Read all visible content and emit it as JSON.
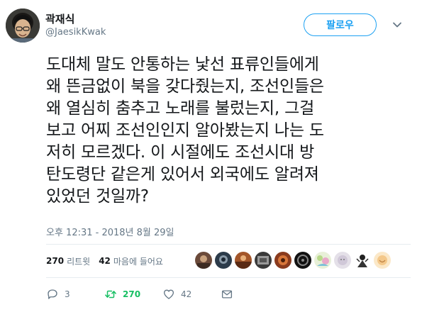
{
  "author": {
    "name": "곽재식",
    "handle": "@JaesikKwak"
  },
  "follow_button": {
    "label": "팔로우",
    "color": "#1da1f2"
  },
  "tweet": {
    "text": "도대체 말도 안통하는 낯선 표류인들에게\n왜 뜬금없이 북을 갖다줬는지, 조선인들은\n왜 열심히 춤추고 노래를 불렀는지, 그걸\n보고 어찌 조선인인지 알아봤는지 나는 도\n저히 모르겠다. 이 시절에도 조선시대 방\n탄도령단 같은게 있어서 외국에도 알려져\n있었던 것일까?",
    "timestamp": "오후 12:31 - 2018년 8월 29일"
  },
  "stats": {
    "retweets_count": "270",
    "retweets_label": "리트윗",
    "likes_count": "42",
    "likes_label": "마음에 들어요"
  },
  "likers": [
    {
      "icon": "avatar-1"
    },
    {
      "icon": "avatar-2"
    },
    {
      "icon": "avatar-3"
    },
    {
      "icon": "avatar-4"
    },
    {
      "icon": "avatar-5"
    },
    {
      "icon": "avatar-6"
    },
    {
      "icon": "avatar-7"
    },
    {
      "icon": "avatar-8"
    },
    {
      "icon": "avatar-9"
    }
  ],
  "actions": {
    "reply_count": "3",
    "retweet_count": "270",
    "like_count": "42",
    "retweet_color": "#17bf63"
  }
}
